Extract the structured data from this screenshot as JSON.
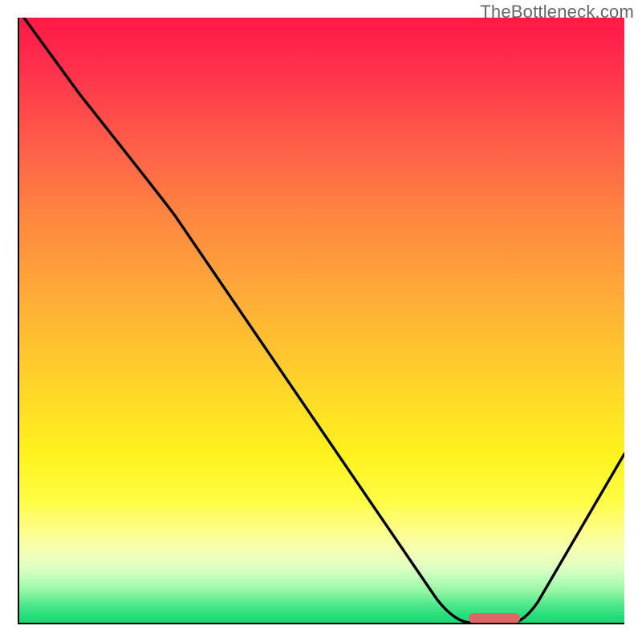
{
  "watermark": "TheBottleneck.com",
  "chart_data": {
    "type": "line",
    "title": "",
    "xlabel": "",
    "ylabel": "",
    "xlim": [
      0,
      100
    ],
    "ylim": [
      0,
      100
    ],
    "x": [
      0,
      12,
      24,
      36,
      48,
      60,
      68,
      74,
      80,
      86,
      92,
      100
    ],
    "values": [
      100,
      88,
      74,
      56,
      38,
      20,
      8,
      2,
      0,
      1,
      8,
      28
    ],
    "background_gradient": {
      "stops": [
        {
          "pct": 0,
          "color": "#ff1946"
        },
        {
          "pct": 20,
          "color": "#ff5a4a"
        },
        {
          "pct": 46,
          "color": "#ffab38"
        },
        {
          "pct": 72,
          "color": "#fff21d"
        },
        {
          "pct": 88,
          "color": "#f6ffb4"
        },
        {
          "pct": 100,
          "color": "#1cd873"
        }
      ]
    },
    "marker": {
      "x_start": 75,
      "x_end": 83,
      "y": 0.5,
      "color": "#e06666",
      "shape": "pill"
    }
  }
}
